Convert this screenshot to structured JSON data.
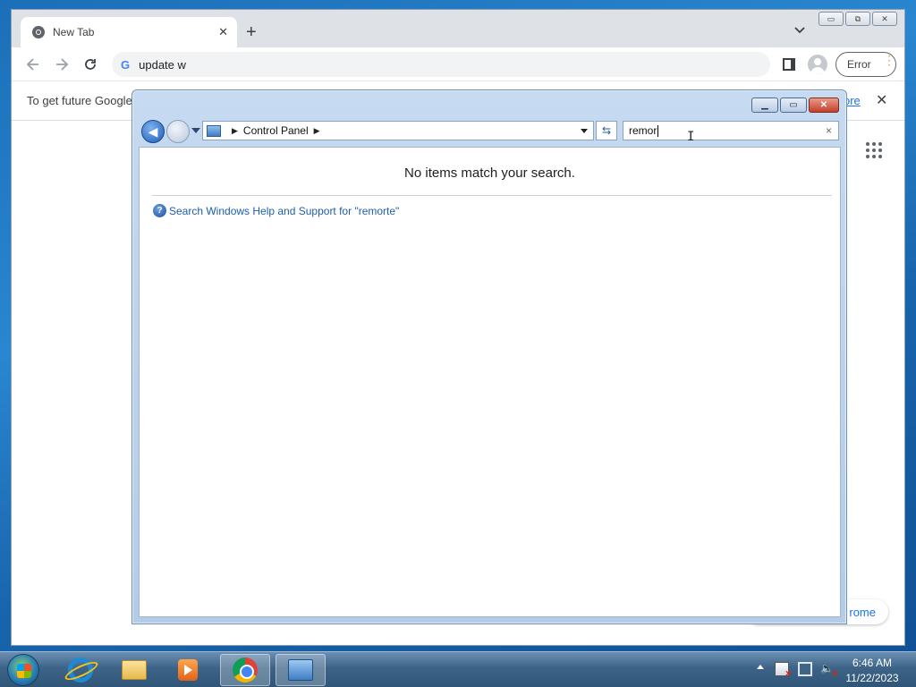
{
  "chrome": {
    "tab_title": "New Tab",
    "tab_close": "✕",
    "new_tab": "+",
    "omnibox_text": "update w",
    "error_label": "Error",
    "menu_dots": "⋮",
    "infobar_text": "To get future Google",
    "infobar_link": "ore",
    "infobar_close": "✕",
    "customize_chip": "rome",
    "window_controls": [
      "▭",
      "⧉",
      "✕"
    ]
  },
  "control_panel": {
    "breadcrumb": "Control Panel",
    "search_value": "remor",
    "search_clear": "×",
    "no_items": "No items match your search.",
    "help_link": "Search Windows Help and Support for \"remorte\"",
    "window_controls": {
      "minimize": "▁",
      "maximize": "▭",
      "close": "✕"
    }
  },
  "taskbar": {
    "items": [
      "internet-explorer",
      "windows-explorer",
      "media-player",
      "google-chrome",
      "control-panel"
    ],
    "clock_time": "6:46 AM",
    "clock_date": "11/22/2023"
  },
  "colors": {
    "desktop": "#1b6fb8",
    "chrome_tabbar": "#dee1e6",
    "link": "#1a73e8",
    "cp_frame": "#c6daf1"
  }
}
